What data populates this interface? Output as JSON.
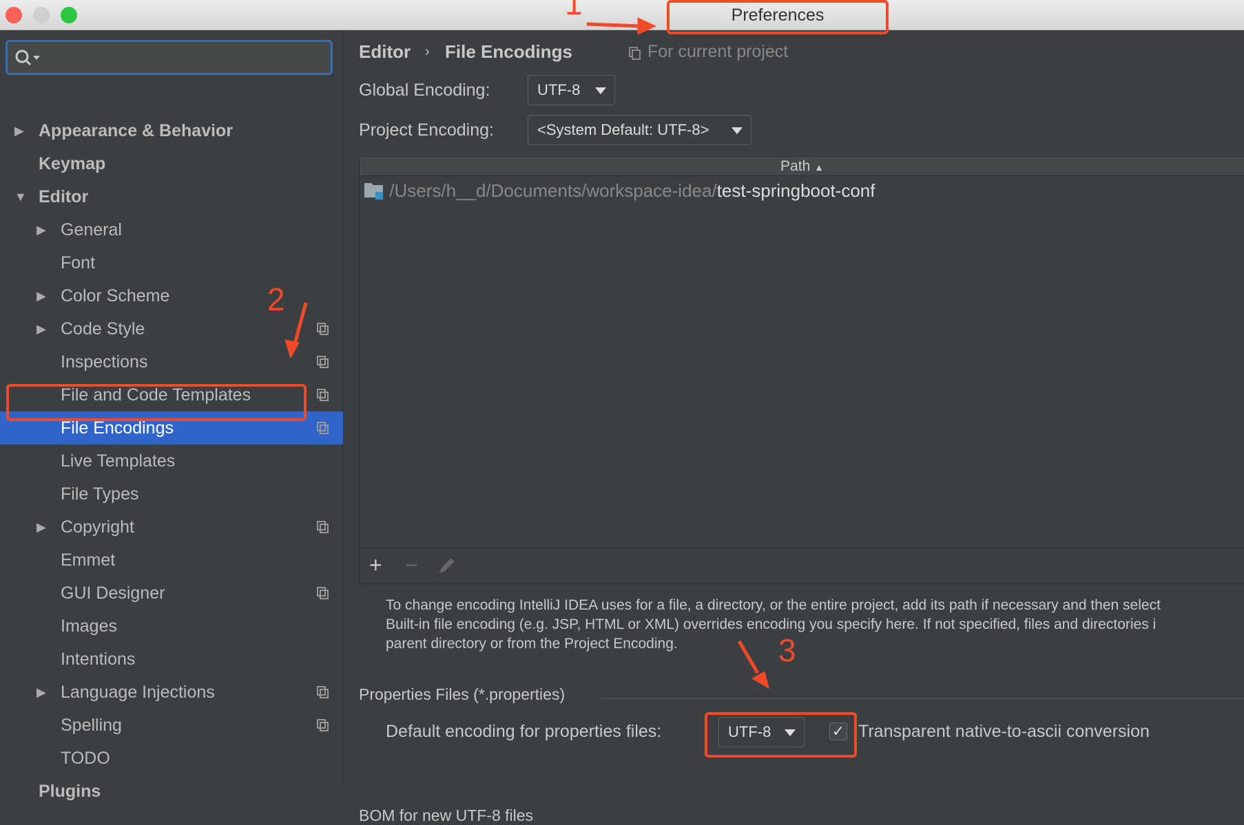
{
  "window": {
    "title": "Preferences"
  },
  "search": {
    "placeholder": ""
  },
  "sidebar": {
    "items": [
      {
        "label": "Appearance & Behavior",
        "level": 0,
        "expander": "collapsed",
        "bold": true
      },
      {
        "label": "Keymap",
        "level": 0,
        "bold": true
      },
      {
        "label": "Editor",
        "level": 0,
        "expander": "expanded",
        "bold": true
      },
      {
        "label": "General",
        "level": 1,
        "expander": "collapsed"
      },
      {
        "label": "Font",
        "level": 1
      },
      {
        "label": "Color Scheme",
        "level": 1,
        "expander": "collapsed"
      },
      {
        "label": "Code Style",
        "level": 1,
        "expander": "collapsed",
        "project": true
      },
      {
        "label": "Inspections",
        "level": 1,
        "project": true
      },
      {
        "label": "File and Code Templates",
        "level": 1,
        "project": true
      },
      {
        "label": "File Encodings",
        "level": 1,
        "project": true,
        "selected": true
      },
      {
        "label": "Live Templates",
        "level": 1
      },
      {
        "label": "File Types",
        "level": 1
      },
      {
        "label": "Copyright",
        "level": 1,
        "expander": "collapsed",
        "project": true
      },
      {
        "label": "Emmet",
        "level": 1
      },
      {
        "label": "GUI Designer",
        "level": 1,
        "project": true
      },
      {
        "label": "Images",
        "level": 1
      },
      {
        "label": "Intentions",
        "level": 1
      },
      {
        "label": "Language Injections",
        "level": 1,
        "expander": "collapsed",
        "project": true
      },
      {
        "label": "Spelling",
        "level": 1,
        "project": true
      },
      {
        "label": "TODO",
        "level": 1
      },
      {
        "label": "Plugins",
        "level": 0,
        "bold": true
      }
    ]
  },
  "breadcrumb": {
    "parent": "Editor",
    "separator": "›",
    "current": "File Encodings",
    "scope": "For current project"
  },
  "global_encoding": {
    "label": "Global Encoding:",
    "value": "UTF-8"
  },
  "project_encoding": {
    "label": "Project Encoding:",
    "value": "<System Default: UTF-8>"
  },
  "table": {
    "column": "Path",
    "sort": "▲",
    "rows": [
      {
        "path_prefix": "/Users/h__d/Documents/workspace-idea/",
        "path_name": "test-springboot-conf"
      }
    ]
  },
  "toolbar": {
    "add": "+",
    "remove": "−"
  },
  "description": [
    "To change encoding IntelliJ IDEA uses for a file, a directory, or the entire project, add its path if necessary and then select",
    "Built-in file encoding (e.g. JSP, HTML or XML) overrides encoding you specify here. If not specified, files and directories i",
    "parent directory or from the Project Encoding."
  ],
  "properties": {
    "section": "Properties Files (*.properties)",
    "label": "Default encoding for properties files:",
    "value": "UTF-8",
    "checkbox_label": "Transparent native-to-ascii conversion",
    "checked": true
  },
  "bom": {
    "section": "BOM for new UTF-8 files"
  },
  "annotations": {
    "one": "1",
    "two": "2",
    "three": "3"
  },
  "colors": {
    "accent": "#2f65ca",
    "annotation": "#f24a28",
    "background": "#3c3f41"
  }
}
